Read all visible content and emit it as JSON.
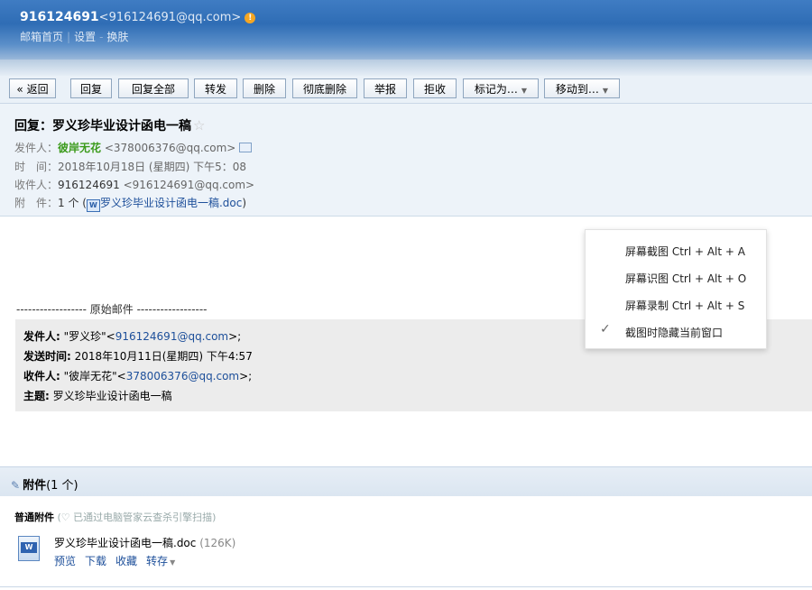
{
  "header": {
    "account_qq": "916124691",
    "account_email": "<916124691@qq.com>",
    "links": [
      "邮箱首页",
      "设置",
      "换肤"
    ]
  },
  "toolbar": {
    "back": "« 返回",
    "reply": "回复",
    "reply_all": "回复全部",
    "forward": "转发",
    "delete": "删除",
    "delete_forever": "彻底删除",
    "report": "举报",
    "reject": "拒收",
    "mark_as": "标记为…",
    "move_to": "移动到…"
  },
  "message": {
    "subject": "回复：罗义珍毕业设计函电一稿",
    "from_label": "发件人：",
    "from_name": "彼岸无花",
    "from_email": "<378006376@qq.com>",
    "time_label": "时　间：",
    "time": "2018年10月18日 (星期四) 下午5：08",
    "to_label": "收件人：",
    "to_name": "916124691",
    "to_email": "<916124691@qq.com>",
    "attach_label": "附　件：",
    "attach_count": "1 个 (",
    "attach_name": "罗义珍毕业设计函电一稿.doc",
    "attach_close": ")"
  },
  "original": {
    "divider": "------------------  原始邮件  ------------------",
    "from_label": "发件人:",
    "from_text": " \"罗义珍\"<",
    "from_email": "916124691@qq.com",
    "from_end": ">;",
    "sent_label": "发送时间:",
    "sent_value": " 2018年10月11日(星期四) 下午4:57",
    "to_label": "收件人:",
    "to_text": " \"彼岸无花\"<",
    "to_email": "378006376@qq.com",
    "to_end": ">;",
    "subject_label": "主题:",
    "subject_value": " 罗义珍毕业设计函电一稿"
  },
  "attachments": {
    "title": "附件",
    "count": "(1 个)",
    "kind": "普通附件",
    "scan_note": "(♡ 已通过电脑管家云查杀引擎扫描)",
    "file_name": "罗义珍毕业设计函电一稿.doc",
    "file_size": "(126K)",
    "actions": [
      "预览",
      "下载",
      "收藏",
      "转存"
    ]
  },
  "context_menu": {
    "items": [
      "屏幕截图 Ctrl + Alt + A",
      "屏幕识图 Ctrl + Alt + O",
      "屏幕录制 Ctrl + Alt + S",
      "截图时隐藏当前窗口"
    ],
    "checked_item": "截图时隐藏当前窗口"
  },
  "colors": {
    "header_blue": "#3f7cc3",
    "sender_green": "#3a9a1a",
    "link_blue": "#1d4f9a"
  }
}
